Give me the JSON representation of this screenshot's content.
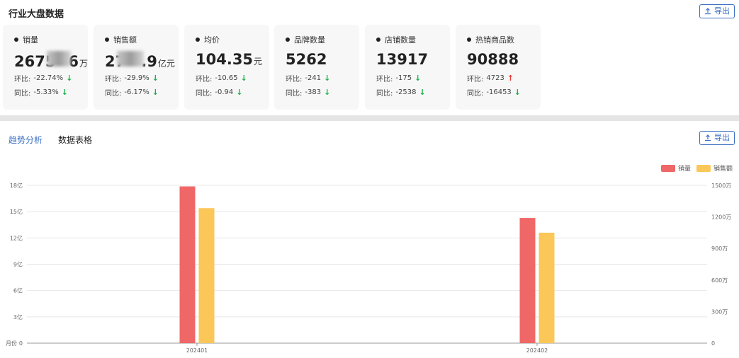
{
  "header": {
    "title": "行业大盘数据",
    "export_label": "导出"
  },
  "cards": [
    {
      "title": "销量",
      "value_prefix": "2675",
      "masked": true,
      "value_suffix": "6",
      "unit": "万",
      "hb_label": "环比:",
      "hb_value": "-22.74%",
      "hb_dir": "down",
      "tb_label": "同比:",
      "tb_value": "-5.33%",
      "tb_dir": "down"
    },
    {
      "title": "销售额",
      "value_prefix": "27",
      "masked": true,
      "value_suffix": ".9",
      "unit": "亿元",
      "hb_label": "环比:",
      "hb_value": "-29.9%",
      "hb_dir": "down",
      "tb_label": "同比:",
      "tb_value": "-6.17%",
      "tb_dir": "down"
    },
    {
      "title": "均价",
      "value_prefix": "104.35",
      "masked": false,
      "value_suffix": "",
      "unit": "元",
      "hb_label": "环比:",
      "hb_value": "-10.65",
      "hb_dir": "down",
      "tb_label": "同比:",
      "tb_value": "-0.94",
      "tb_dir": "down"
    },
    {
      "title": "品牌数量",
      "value_prefix": "5262",
      "masked": false,
      "value_suffix": "",
      "unit": "",
      "hb_label": "环比:",
      "hb_value": "-241",
      "hb_dir": "down",
      "tb_label": "同比:",
      "tb_value": "-383",
      "tb_dir": "down"
    },
    {
      "title": "店铺数量",
      "value_prefix": "13917",
      "masked": false,
      "value_suffix": "",
      "unit": "",
      "hb_label": "环比:",
      "hb_value": "-175",
      "hb_dir": "down",
      "tb_label": "同比:",
      "tb_value": "-2538",
      "tb_dir": "down"
    },
    {
      "title": "热销商品数",
      "value_prefix": "90888",
      "masked": false,
      "value_suffix": "",
      "unit": "",
      "hb_label": "环比:",
      "hb_value": "4723",
      "hb_dir": "up",
      "tb_label": "同比:",
      "tb_value": "-16453",
      "tb_dir": "down"
    }
  ],
  "tabs": [
    {
      "label": "趋势分析",
      "active": true
    },
    {
      "label": "数据表格",
      "active": false
    }
  ],
  "section_export_label": "导出",
  "colors": {
    "accent": "#3a6fc4",
    "series_sales_volume": "#ef6767",
    "series_sales_amount": "#fbc758",
    "down": "#1ab04a",
    "up": "#e83838"
  },
  "chart_data": {
    "type": "bar",
    "categories": [
      "202401",
      "202402"
    ],
    "series": [
      {
        "name": "销量",
        "axis": "right",
        "values": [
          1490,
          1190
        ]
      },
      {
        "name": "销售额",
        "axis": "left",
        "values": [
          15.4,
          12.6
        ]
      }
    ],
    "left_axis": {
      "ticks": [
        "0",
        "3亿",
        "6亿",
        "9亿",
        "12亿",
        "15亿",
        "18亿"
      ],
      "range": [
        0,
        18
      ],
      "label": "月份"
    },
    "right_axis": {
      "ticks": [
        "0",
        "300万",
        "600万",
        "900万",
        "1200万",
        "1500万"
      ],
      "range": [
        0,
        1500
      ]
    },
    "legend_position": "top-right",
    "grid": true
  }
}
